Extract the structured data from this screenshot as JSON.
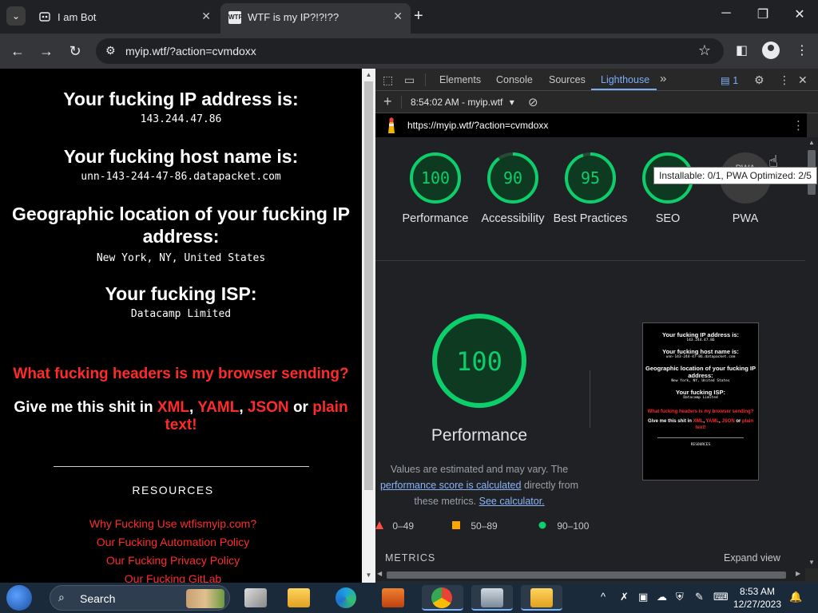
{
  "browser": {
    "tabs": [
      {
        "title": "I am Bot",
        "favicon": "bot-favicon",
        "active": false
      },
      {
        "title": "WTF is my IP?!?!??",
        "favicon": "wtf-favicon",
        "active": true
      }
    ],
    "favicon_text": "WTF",
    "url": "myip.wtf/?action=cvmdoxx",
    "icons": {
      "tab_search": "chevron-down-icon",
      "new_tab": "+",
      "minimize": "─",
      "restore": "❐",
      "close": "✕",
      "back": "←",
      "forward": "→",
      "reload": "↻",
      "site_info": "⚙",
      "bookmark": "☆",
      "side_panel": "◧",
      "menu": "⋮"
    }
  },
  "page": {
    "ip_heading": "Your fucking IP address is:",
    "ip_value": "143.244.47.86",
    "host_heading": "Your fucking host name is:",
    "host_value": "unn-143-244-47-86.datapacket.com",
    "geo_heading": "Geographic location of your fucking IP address:",
    "geo_value": "New York, NY, United States",
    "isp_heading": "Your fucking ISP:",
    "isp_value": "Datacamp Limited",
    "headers_link": "What fucking headers is my browser sending?",
    "give_me": "Give me this shit in",
    "formats": [
      "XML",
      "YAML",
      "JSON"
    ],
    "or": "or",
    "plain_text": "plain text!",
    "resources_heading": "RESOURCES",
    "resource_links": [
      "Why Fucking Use wtfismyip.com?",
      "Our Fucking Automation Policy",
      "Our Fucking Privacy Policy",
      "Our Fucking GitLab"
    ]
  },
  "devtools": {
    "tabs": [
      "Elements",
      "Console",
      "Sources",
      "Lighthouse"
    ],
    "active_tab": "Lighthouse",
    "more_tabs": "»",
    "issues_count": "1",
    "report_selector": "8:54:02 AM - myip.wtf",
    "audited_url": "https://myip.wtf/?action=cvmdoxx",
    "scores": [
      {
        "label": "Performance",
        "score": 100
      },
      {
        "label": "Accessibility",
        "score": 90
      },
      {
        "label": "Best Practices",
        "score": 95
      },
      {
        "label": "SEO",
        "score": 100
      },
      {
        "label": "PWA",
        "score": null
      }
    ],
    "pwa_partial": "PWA",
    "tooltip": "Installable: 0/1, PWA Optimized: 2/5",
    "big_score": "100",
    "big_label": "Performance",
    "desc_1": "Values are estimated and may vary. The",
    "desc_link_1": "performance score is calculated",
    "desc_2": "directly from these metrics.",
    "desc_link_2": "See calculator.",
    "legend": [
      {
        "range": "0–49",
        "color": "#ff4e42"
      },
      {
        "range": "50–89",
        "color": "#ffa400"
      },
      {
        "range": "90–100",
        "color": "#0cce6b"
      }
    ],
    "metrics_label": "METRICS",
    "expand_view": "Expand view",
    "colors": {
      "pass": "#0cce6b",
      "accent": "#7cacf8"
    }
  },
  "taskbar": {
    "search_label": "Search",
    "time": "8:53 AM",
    "date": "12/27/2023",
    "tray_up": "^"
  }
}
